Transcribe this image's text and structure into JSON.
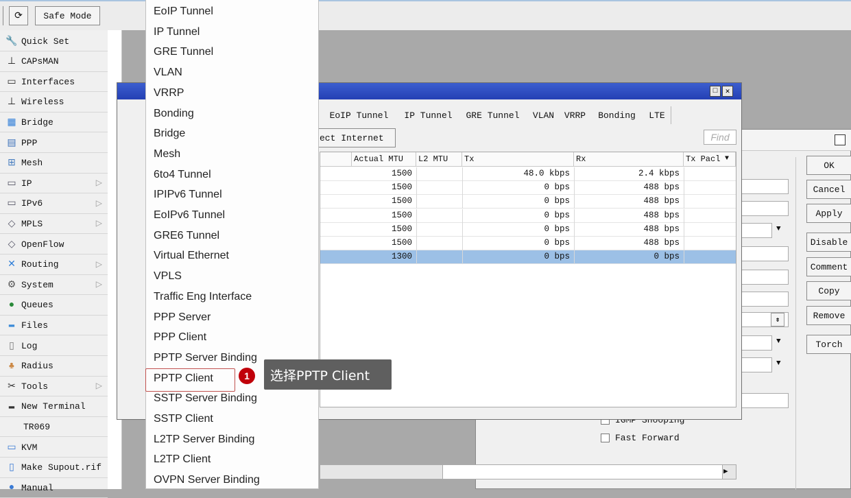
{
  "toolbar": {
    "refresh_icon": "refresh-icon",
    "safe_mode_label": "Safe Mode"
  },
  "sidebar": {
    "items": [
      {
        "label": "Quick Set",
        "icon": "quickset-icon",
        "glyph": "🔧",
        "sub": false
      },
      {
        "label": "CAPsMAN",
        "icon": "antenna-icon",
        "glyph": "⊥",
        "sub": false
      },
      {
        "label": "Interfaces",
        "icon": "interfaces-icon",
        "glyph": "▭",
        "sub": false
      },
      {
        "label": "Wireless",
        "icon": "wireless-icon",
        "glyph": "⊥",
        "sub": false
      },
      {
        "label": "Bridge",
        "icon": "bridge-icon",
        "glyph": "▦",
        "sub": false
      },
      {
        "label": "PPP",
        "icon": "ppp-icon",
        "glyph": "▤",
        "sub": false
      },
      {
        "label": "Mesh",
        "icon": "mesh-icon",
        "glyph": "⊞",
        "sub": false
      },
      {
        "label": "IP",
        "icon": "ip-icon",
        "glyph": "▭",
        "sub": true
      },
      {
        "label": "IPv6",
        "icon": "ipv6-icon",
        "glyph": "▭",
        "sub": true
      },
      {
        "label": "MPLS",
        "icon": "mpls-icon",
        "glyph": "◇",
        "sub": true
      },
      {
        "label": "OpenFlow",
        "icon": "openflow-icon",
        "glyph": "◇",
        "sub": false
      },
      {
        "label": "Routing",
        "icon": "routing-icon",
        "glyph": "✕",
        "sub": true
      },
      {
        "label": "System",
        "icon": "gear-icon",
        "glyph": "⚙",
        "sub": true
      },
      {
        "label": "Queues",
        "icon": "queues-icon",
        "glyph": "●",
        "sub": false
      },
      {
        "label": "Files",
        "icon": "folder-icon",
        "glyph": "▬",
        "sub": false
      },
      {
        "label": "Log",
        "icon": "log-icon",
        "glyph": "▯",
        "sub": false
      },
      {
        "label": "Radius",
        "icon": "radius-icon",
        "glyph": "♣",
        "sub": false
      },
      {
        "label": "Tools",
        "icon": "tools-icon",
        "glyph": "✂",
        "sub": true
      },
      {
        "label": "New Terminal",
        "icon": "terminal-icon",
        "glyph": "▬",
        "sub": false
      },
      {
        "label": "TR069",
        "icon": "",
        "glyph": "",
        "sub": false
      },
      {
        "label": "KVM",
        "icon": "kvm-icon",
        "glyph": "▭",
        "sub": false
      },
      {
        "label": "Make Supout.rif",
        "icon": "supout-icon",
        "glyph": "▯",
        "sub": false
      },
      {
        "label": "Manual",
        "icon": "manual-icon",
        "glyph": "●",
        "sub": false
      }
    ]
  },
  "menu": {
    "items": [
      "EoIP Tunnel",
      "IP Tunnel",
      "GRE Tunnel",
      "VLAN",
      "VRRP",
      "Bonding",
      "Bridge",
      "Mesh",
      "6to4 Tunnel",
      "IPIPv6 Tunnel",
      "EoIPv6 Tunnel",
      "GRE6 Tunnel",
      "Virtual Ethernet",
      "VPLS",
      "Traffic Eng Interface",
      "PPP Server",
      "PPP Client",
      "PPTP Server Binding",
      "PPTP Client",
      "SSTP Server Binding",
      "SSTP Client",
      "L2TP Server Binding",
      "L2TP Client",
      "OVPN Server Binding"
    ],
    "highlighted": "PPTP Client"
  },
  "callout": {
    "number": "1",
    "text": "选择PPTP Client"
  },
  "interface_window": {
    "tabs": [
      "EoIP Tunnel",
      "IP Tunnel",
      "GRE Tunnel",
      "VLAN",
      "VRRP",
      "Bonding",
      "LTE"
    ],
    "toolbar_button": "ect Internet",
    "find_placeholder": "Find",
    "columns": [
      "Actual MTU",
      "L2 MTU",
      "Tx",
      "Rx",
      "Tx Pacl"
    ],
    "rows": [
      {
        "mtu": "1500",
        "l2": "",
        "tx": "48.0 kbps",
        "rx": "2.4 kbps",
        "selected": false
      },
      {
        "mtu": "1500",
        "l2": "",
        "tx": "0 bps",
        "rx": "488 bps",
        "selected": false
      },
      {
        "mtu": "1500",
        "l2": "",
        "tx": "0 bps",
        "rx": "488 bps",
        "selected": false
      },
      {
        "mtu": "1500",
        "l2": "",
        "tx": "0 bps",
        "rx": "488 bps",
        "selected": false
      },
      {
        "mtu": "1500",
        "l2": "",
        "tx": "0 bps",
        "rx": "488 bps",
        "selected": false
      },
      {
        "mtu": "1500",
        "l2": "",
        "tx": "0 bps",
        "rx": "488 bps",
        "selected": false
      },
      {
        "mtu": "1300",
        "l2": "",
        "tx": "0 bps",
        "rx": "0 bps",
        "selected": true
      }
    ]
  },
  "dialog": {
    "buttons": [
      "OK",
      "Cancel",
      "Apply",
      "Disable",
      "Comment",
      "Copy",
      "Remove",
      "Torch"
    ],
    "checkboxes": [
      "IGMP Snooping",
      "Fast Forward"
    ]
  }
}
